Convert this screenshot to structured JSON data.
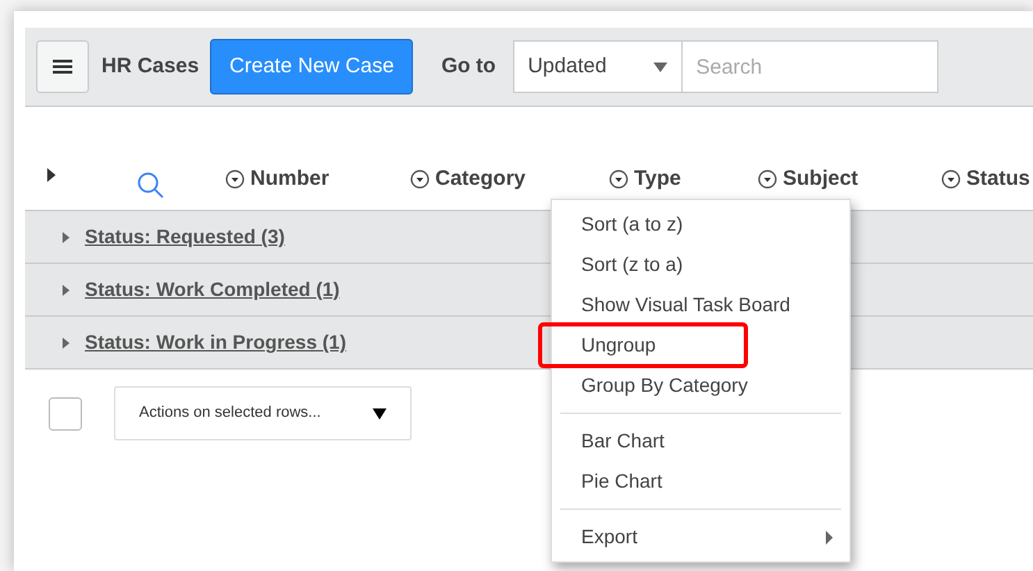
{
  "toolbar": {
    "title": "HR Cases",
    "create_button": "Create New Case",
    "goto_label": "Go to",
    "goto_select": "Updated",
    "search": {
      "placeholder": "Search"
    }
  },
  "columns": [
    "Number",
    "Category",
    "Type",
    "Subject",
    "Status"
  ],
  "groups": [
    {
      "label": "Status: Requested (3)",
      "expanded": false
    },
    {
      "label": "Status: Work Completed (1)",
      "expanded": false
    },
    {
      "label": "Status: Work in Progress (1)",
      "expanded": false
    }
  ],
  "footer": {
    "select_all_checked": false,
    "actions_select": "Actions on selected rows..."
  },
  "context_menu": [
    [
      {
        "label": "Sort (a to z)",
        "highlighted": false,
        "kind": "action"
      },
      {
        "label": "Sort (z to a)",
        "highlighted": false,
        "kind": "action"
      },
      {
        "label": "Show Visual Task Board",
        "highlighted": false,
        "kind": "action"
      },
      {
        "label": "Ungroup",
        "highlighted": true,
        "kind": "action"
      },
      {
        "label": "Group By Category",
        "highlighted": false,
        "kind": "action"
      }
    ],
    [
      {
        "label": "Bar Chart",
        "highlighted": false,
        "kind": "action"
      },
      {
        "label": "Pie Chart",
        "highlighted": false,
        "kind": "action"
      }
    ],
    [
      {
        "label": "Export",
        "highlighted": false,
        "kind": "submenu"
      }
    ]
  ]
}
